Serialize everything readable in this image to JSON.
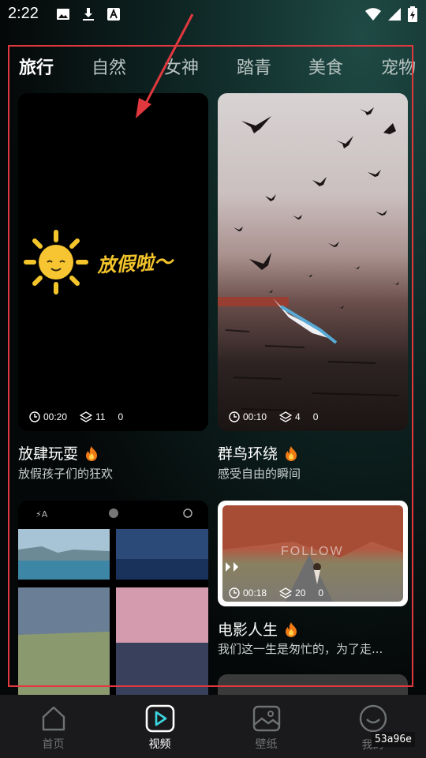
{
  "status_bar": {
    "time": "2:22"
  },
  "tabs": [
    {
      "label": "旅行",
      "active": true
    },
    {
      "label": "自然"
    },
    {
      "label": "女神"
    },
    {
      "label": "踏青"
    },
    {
      "label": "美食"
    },
    {
      "label": "宠物"
    }
  ],
  "videos": [
    {
      "duration": "00:20",
      "layers": "11",
      "likes": "0",
      "title": "放肆玩耍",
      "subtitle": "放假孩子们的狂欢",
      "overlay_text": "放假啦～"
    },
    {
      "duration": "00:10",
      "layers": "4",
      "likes": "0",
      "title": "群鸟环绕",
      "subtitle": "感受自由的瞬间"
    },
    {
      "duration": "00:18",
      "layers": "20",
      "likes": "0",
      "title": "电影人生",
      "subtitle": "我们这一生是匆忙的，为了走...",
      "overlay_text": "FOLLOW"
    }
  ],
  "bottom_nav": [
    {
      "label": "首页",
      "icon": "home-icon"
    },
    {
      "label": "视频",
      "icon": "play-icon",
      "active": true
    },
    {
      "label": "壁纸",
      "icon": "wallpaper-icon"
    },
    {
      "label": "我的",
      "icon": "profile-icon"
    }
  ],
  "watermark": "53a96e",
  "colors": {
    "accent_red": "#e0383e",
    "flame": "#f07a14",
    "background": "#070b0b"
  }
}
